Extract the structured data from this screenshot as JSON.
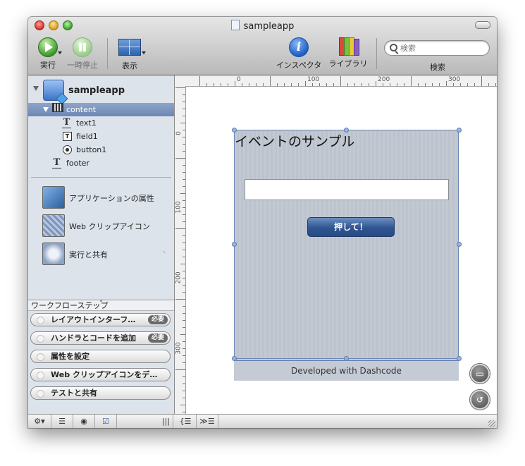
{
  "window": {
    "title": "sampleapp"
  },
  "toolbar": {
    "run_label": "実行",
    "pause_label": "一時停止",
    "view_label": "表示",
    "inspector_label": "インスペクタ",
    "library_label": "ライブラリ",
    "search_placeholder": "検索",
    "search_label": "検索"
  },
  "sidebar": {
    "project": "sampleapp",
    "tree": [
      {
        "label": "content",
        "icon": "film-strip-icon",
        "selected": true
      },
      {
        "label": "text1",
        "icon": "text-part-icon"
      },
      {
        "label": "field1",
        "icon": "text-field-icon"
      },
      {
        "label": "button1",
        "icon": "button-icon"
      },
      {
        "label": "footer",
        "icon": "text-part-icon"
      }
    ],
    "settings": [
      {
        "label": "アプリケーションの属性",
        "icon": "app-attributes-icon"
      },
      {
        "label": "Web クリップアイコン",
        "icon": "web-clip-icon"
      },
      {
        "label": "実行と共有",
        "icon": "run-share-icon"
      }
    ]
  },
  "workflow": {
    "header": "ワークフローステップ",
    "steps": [
      {
        "label": "レイアウトインターフ…",
        "badge": "必要"
      },
      {
        "label": "ハンドラとコードを追加",
        "badge": "必要"
      },
      {
        "label": "属性を設定",
        "badge": ""
      },
      {
        "label": "Web クリップアイコンをデ…",
        "badge": ""
      },
      {
        "label": "テストと共有",
        "badge": ""
      }
    ]
  },
  "ruler": {
    "top": [
      "0",
      "100",
      "200",
      "300"
    ],
    "left": [
      "0",
      "100",
      "200",
      "300"
    ]
  },
  "canvas": {
    "title": "イベントのサンプル",
    "input_value": "",
    "button_label": "押して！",
    "footer": "Developed with Dashcode"
  },
  "bottombar": {
    "gear": "⚙▾",
    "list": "☰",
    "target": "◉",
    "check": "☑",
    "cols": "|||",
    "brace": "{☰",
    "code": "≫☰"
  },
  "colors": {
    "selection": "#7a93be",
    "widget_border": "#6b86b6",
    "button": "#2f5592"
  }
}
